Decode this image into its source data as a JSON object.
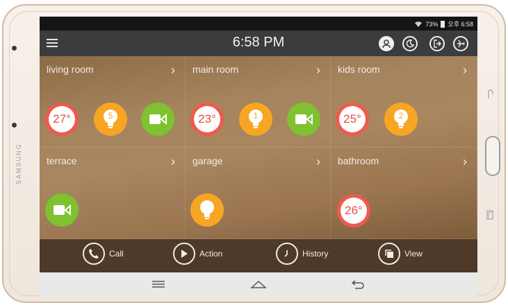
{
  "device": {
    "brand": "SAMSUNG"
  },
  "status_bar": {
    "battery": "73%",
    "time": "오후 6:58"
  },
  "top_bar": {
    "time": "6:58 PM"
  },
  "rooms": [
    {
      "name": "living room",
      "devices": [
        {
          "type": "thermostat",
          "value": "27°"
        },
        {
          "type": "light",
          "value": "5"
        },
        {
          "type": "camera"
        }
      ]
    },
    {
      "name": "main room",
      "devices": [
        {
          "type": "thermostat",
          "value": "23°"
        },
        {
          "type": "light",
          "value": "1"
        },
        {
          "type": "camera"
        }
      ]
    },
    {
      "name": "kids room",
      "devices": [
        {
          "type": "thermostat",
          "value": "25°"
        },
        {
          "type": "light",
          "value": "2"
        }
      ]
    },
    {
      "name": "terrace",
      "devices": [
        {
          "type": "camera"
        }
      ]
    },
    {
      "name": "garage",
      "devices": [
        {
          "type": "light",
          "value": ""
        }
      ]
    },
    {
      "name": "bathroom",
      "devices": [
        {
          "type": "thermostat",
          "value": "26°"
        }
      ]
    }
  ],
  "actions": [
    {
      "label": "Call",
      "icon": "phone-icon"
    },
    {
      "label": "Action",
      "icon": "play-icon"
    },
    {
      "label": "History",
      "icon": "clock-icon"
    },
    {
      "label": "View",
      "icon": "view-icon"
    }
  ],
  "colors": {
    "thermostat": "#ef5a4e",
    "light": "#f6a623",
    "camera": "#7ec230",
    "action_bar": "#4e3a28",
    "top_bar": "#3c3c3c"
  }
}
